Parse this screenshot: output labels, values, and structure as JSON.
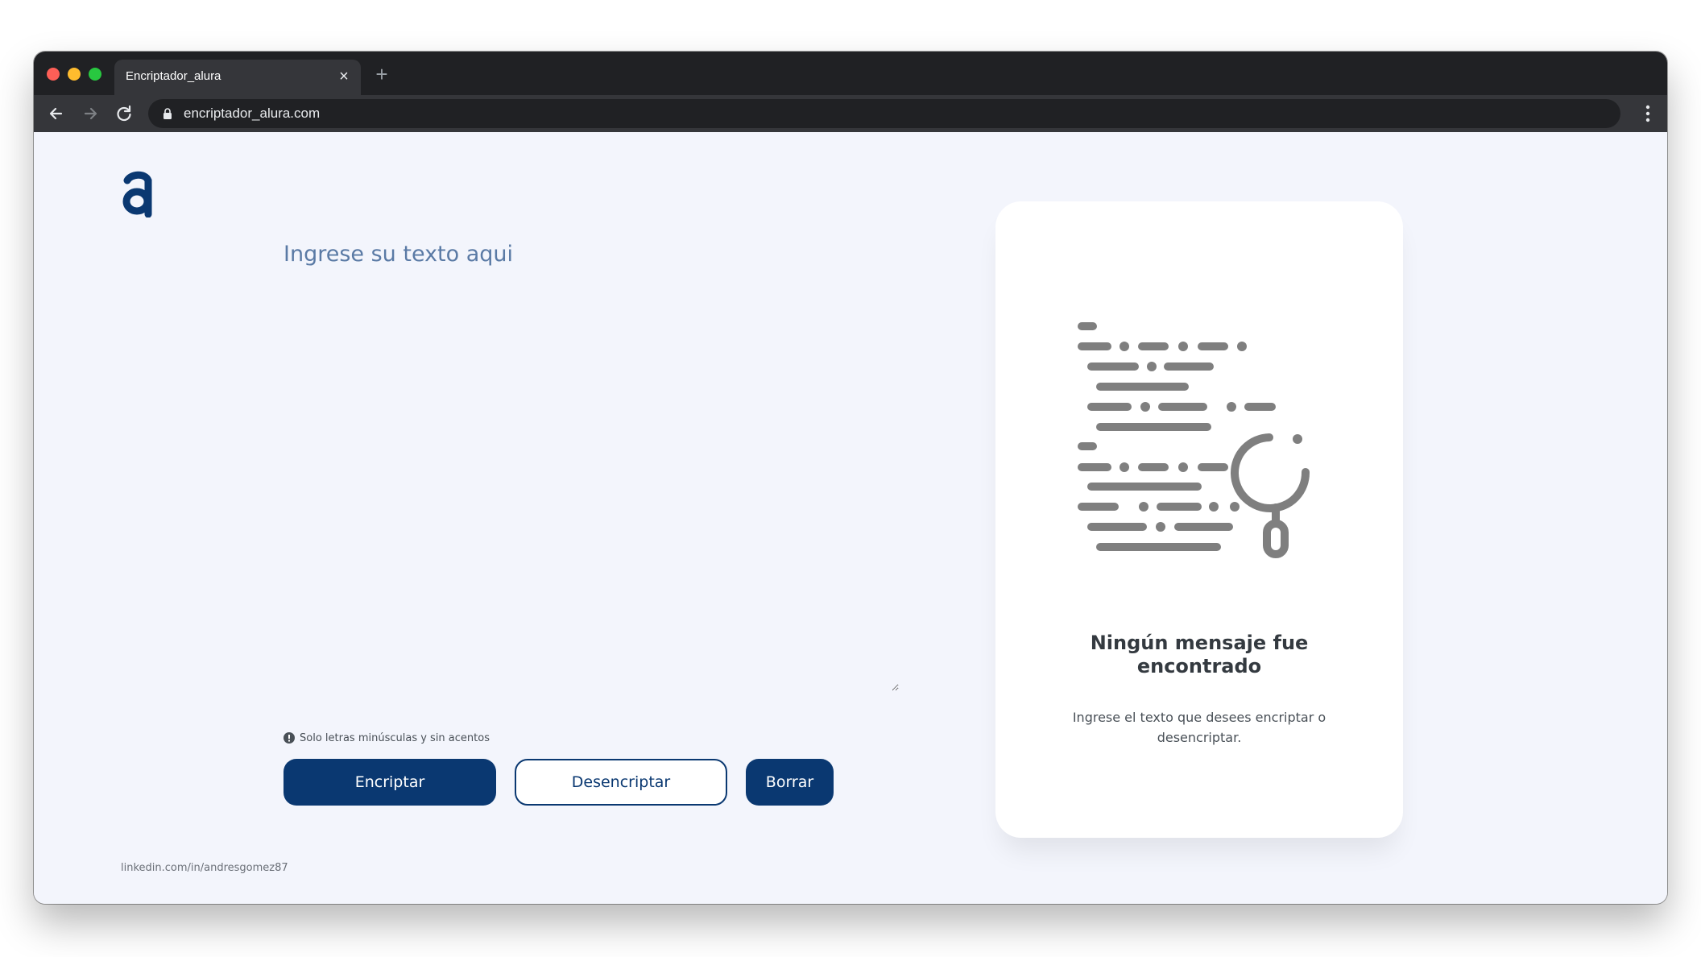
{
  "browser": {
    "tab_title": "Encriptador_alura",
    "url": "encriptador_alura.com"
  },
  "icons": {
    "close": "close-icon",
    "new_tab": "plus-icon",
    "back": "arrow-left-icon",
    "forward": "arrow-right-icon",
    "reload": "reload-icon",
    "lock": "lock-icon",
    "menu": "kebab-menu-icon",
    "info": "info-icon",
    "logo": "alura-logo"
  },
  "colors": {
    "primary": "#0a3871",
    "heading": "#5a7aa5",
    "background": "#f3f5fc",
    "illustration": "#7f7f7f"
  },
  "input": {
    "placeholder": "Ingrese su texto aqui",
    "value": ""
  },
  "hint": {
    "text": "Solo letras minúsculas y sin acentos"
  },
  "buttons": {
    "encrypt": "Encriptar",
    "decrypt": "Desencriptar",
    "clear": "Borrar"
  },
  "footer": {
    "link": "linkedin.com/in/andresgomez87"
  },
  "result_panel": {
    "title": "Ningún mensaje fue encontrado",
    "description": "Ingrese el texto que desees encriptar o desencriptar."
  }
}
